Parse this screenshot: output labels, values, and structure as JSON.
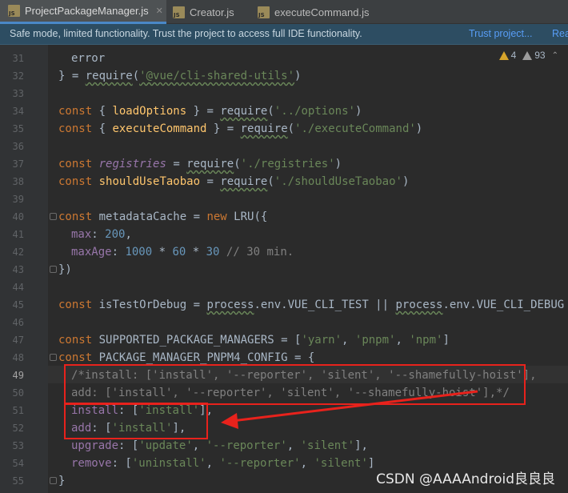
{
  "tabs": [
    {
      "label": "ProjectPackageManager.js",
      "active": true
    },
    {
      "label": "Creator.js",
      "active": false
    },
    {
      "label": "executeCommand.js",
      "active": false
    }
  ],
  "banner": {
    "message": "Safe mode, limited functionality. Trust the project to access full IDE functionality.",
    "trust_link": "Trust project...",
    "read_link": "Rea"
  },
  "inspections": {
    "warnings": "4",
    "weak_warnings": "93"
  },
  "line_numbers": [
    "31",
    "32",
    "33",
    "34",
    "35",
    "36",
    "37",
    "38",
    "39",
    "40",
    "41",
    "42",
    "43",
    "44",
    "45",
    "46",
    "47",
    "48",
    "49",
    "50",
    "51",
    "52",
    "53",
    "54",
    "55"
  ],
  "current_line": "49",
  "code": {
    "l31_error": "error",
    "l32_brace": "} = ",
    "l32_require": "require",
    "l32_arg": "'@vue/cli-shared-utils'",
    "l34_const": "const",
    "l34_open": " { ",
    "l34_name": "loadOptions",
    "l34_close": " } = ",
    "l34_require": "require",
    "l34_arg": "'../options'",
    "l35_const": "const",
    "l35_open": " { ",
    "l35_name": "executeCommand",
    "l35_close": " } = ",
    "l35_require": "require",
    "l35_arg": "'./executeCommand'",
    "l37_const": "const",
    "l37_name": "registries",
    "l37_eq": " = ",
    "l37_require": "require",
    "l37_arg": "'./registries'",
    "l38_const": "const",
    "l38_name": "shouldUseTaobao",
    "l38_eq": " = ",
    "l38_require": "require",
    "l38_arg": "'./shouldUseTaobao'",
    "l40_const": "const",
    "l40_name": " metadataCache = ",
    "l40_new": "new",
    "l40_cls": " LRU({",
    "l41_key": "max",
    "l41_val": "200",
    "l42_key": "maxAge",
    "l42_n1": "1000",
    "l42_n2": "60",
    "l42_n3": "30",
    "l42_cmt": "// 30 min.",
    "l43_close": "})",
    "l45_const": "const",
    "l45_name": " isTestOrDebug = ",
    "l45_p1": "process",
    "l45_env1": ".env.VUE_CLI_TEST || ",
    "l45_p2": "process",
    "l45_env2": ".env.VUE_CLI_DEBUG",
    "l47_const": "const",
    "l47_name": " SUPPORTED_PACKAGE_MANAGERS = [",
    "l47_s1": "'yarn'",
    "l47_s2": "'pnpm'",
    "l47_s3": "'npm'",
    "l48_const": "const",
    "l48_name": " PACKAGE_MANAGER_PNPM4_CONFIG = {",
    "l49_comment": "/*install: ['install', '--reporter', 'silent', '--shamefully-hoist'],",
    "l50_comment": "add: ['install', '--reporter', 'silent', '--shamefully-hoist'],*/",
    "l51_key": "install",
    "l51_val": "'install'",
    "l52_key": "add",
    "l52_val": "'install'",
    "l53_key": "upgrade",
    "l53_s1": "'update'",
    "l53_s2": "'--reporter'",
    "l53_s3": "'silent'",
    "l54_key": "remove",
    "l54_s1": "'uninstall'",
    "l54_s2": "'--reporter'",
    "l54_s3": "'silent'",
    "l55_close": "}"
  },
  "watermark": "CSDN @AAAAndroid良良良",
  "colors": {
    "annotation": "#e8221c",
    "accent": "#4a88c7"
  }
}
